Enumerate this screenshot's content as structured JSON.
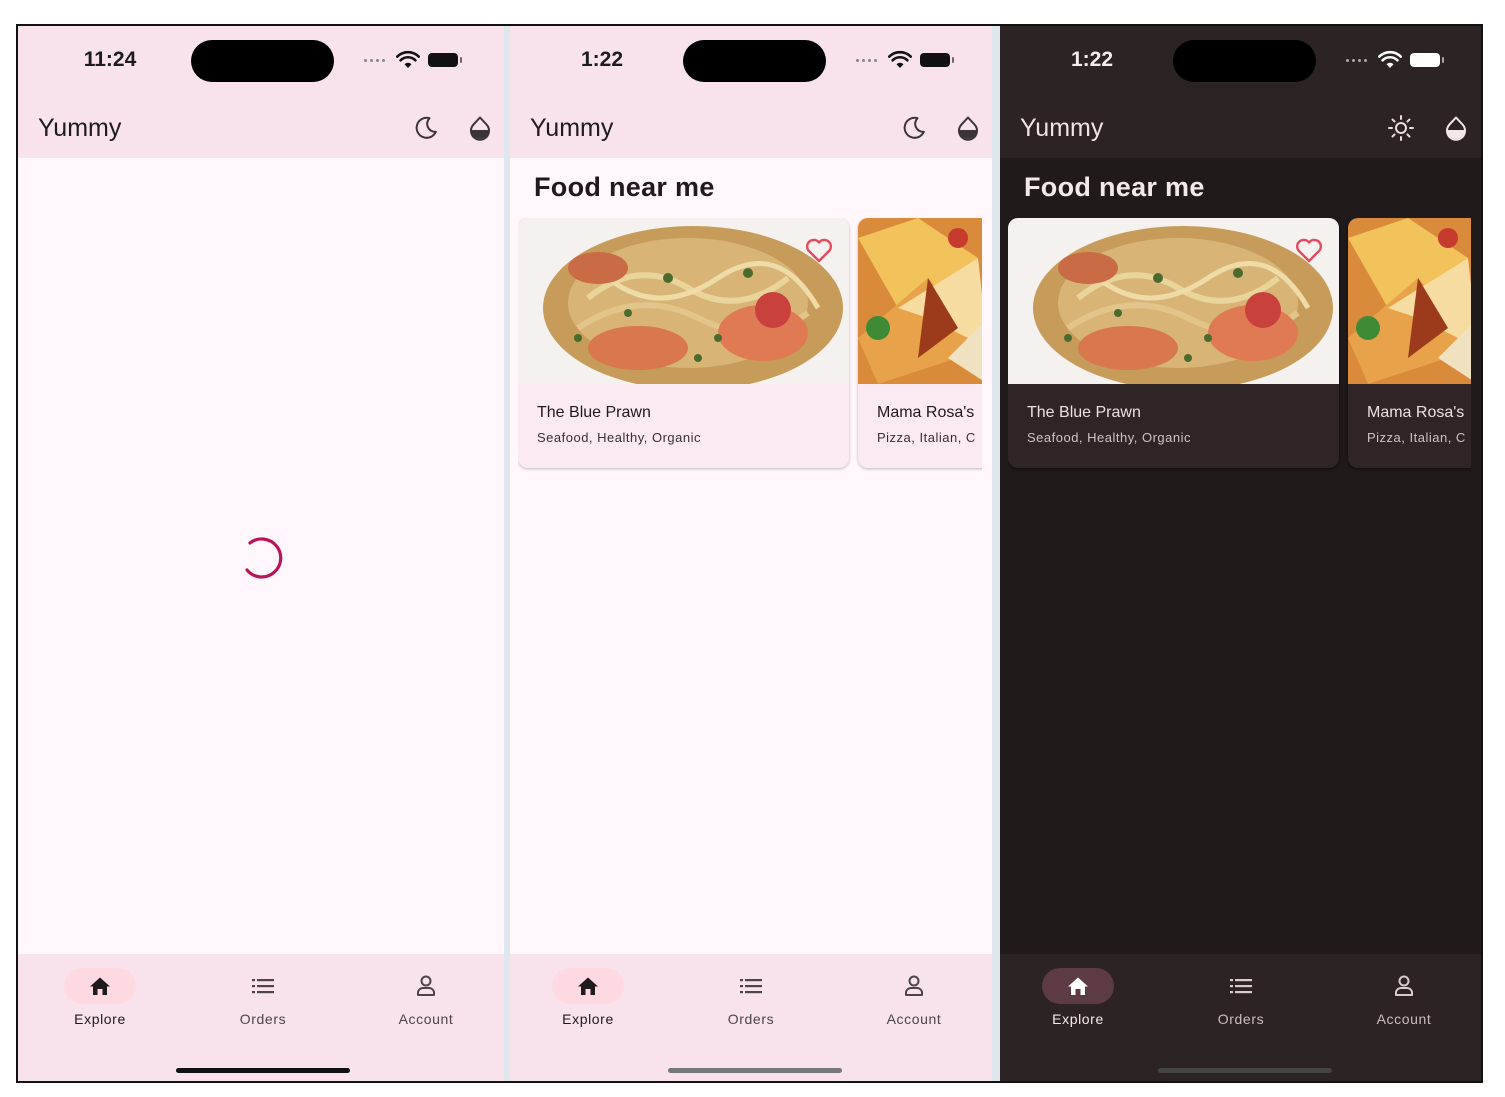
{
  "colors": {
    "light_background": "#fff7fb",
    "light_bar": "#f8e3ed",
    "dark_background": "#201a1b",
    "dark_bar": "#2c2325",
    "accent": "#b8145a",
    "favorite": "#e24a5f"
  },
  "screens": [
    {
      "theme": "light",
      "time": "11:24",
      "app_title": "Yummy",
      "theme_toggle_icon": "moon-icon",
      "color_icon": "droplet-icon",
      "state": "loading",
      "nav": [
        {
          "label": "Explore",
          "icon": "home-icon",
          "active": true
        },
        {
          "label": "Orders",
          "icon": "list-icon",
          "active": false
        },
        {
          "label": "Account",
          "icon": "person-icon",
          "active": false
        }
      ]
    },
    {
      "theme": "light",
      "time": "1:22",
      "app_title": "Yummy",
      "theme_toggle_icon": "moon-icon",
      "color_icon": "droplet-icon",
      "section_title": "Food near me",
      "restaurants": [
        {
          "name": "The Blue Prawn",
          "tags": "Seafood, Healthy, Organic",
          "favorite_icon": "heart-icon"
        },
        {
          "name": "Mama Rosa's",
          "tags": "Pizza, Italian, C"
        }
      ],
      "nav": [
        {
          "label": "Explore",
          "icon": "home-icon",
          "active": true
        },
        {
          "label": "Orders",
          "icon": "list-icon",
          "active": false
        },
        {
          "label": "Account",
          "icon": "person-icon",
          "active": false
        }
      ]
    },
    {
      "theme": "dark",
      "time": "1:22",
      "app_title": "Yummy",
      "theme_toggle_icon": "sun-icon",
      "color_icon": "droplet-icon",
      "section_title": "Food near me",
      "restaurants": [
        {
          "name": "The Blue Prawn",
          "tags": "Seafood, Healthy, Organic",
          "favorite_icon": "heart-icon"
        },
        {
          "name": "Mama Rosa's",
          "tags": "Pizza, Italian, C"
        }
      ],
      "nav": [
        {
          "label": "Explore",
          "icon": "home-icon",
          "active": true
        },
        {
          "label": "Orders",
          "icon": "list-icon",
          "active": false
        },
        {
          "label": "Account",
          "icon": "person-icon",
          "active": false
        }
      ]
    }
  ]
}
